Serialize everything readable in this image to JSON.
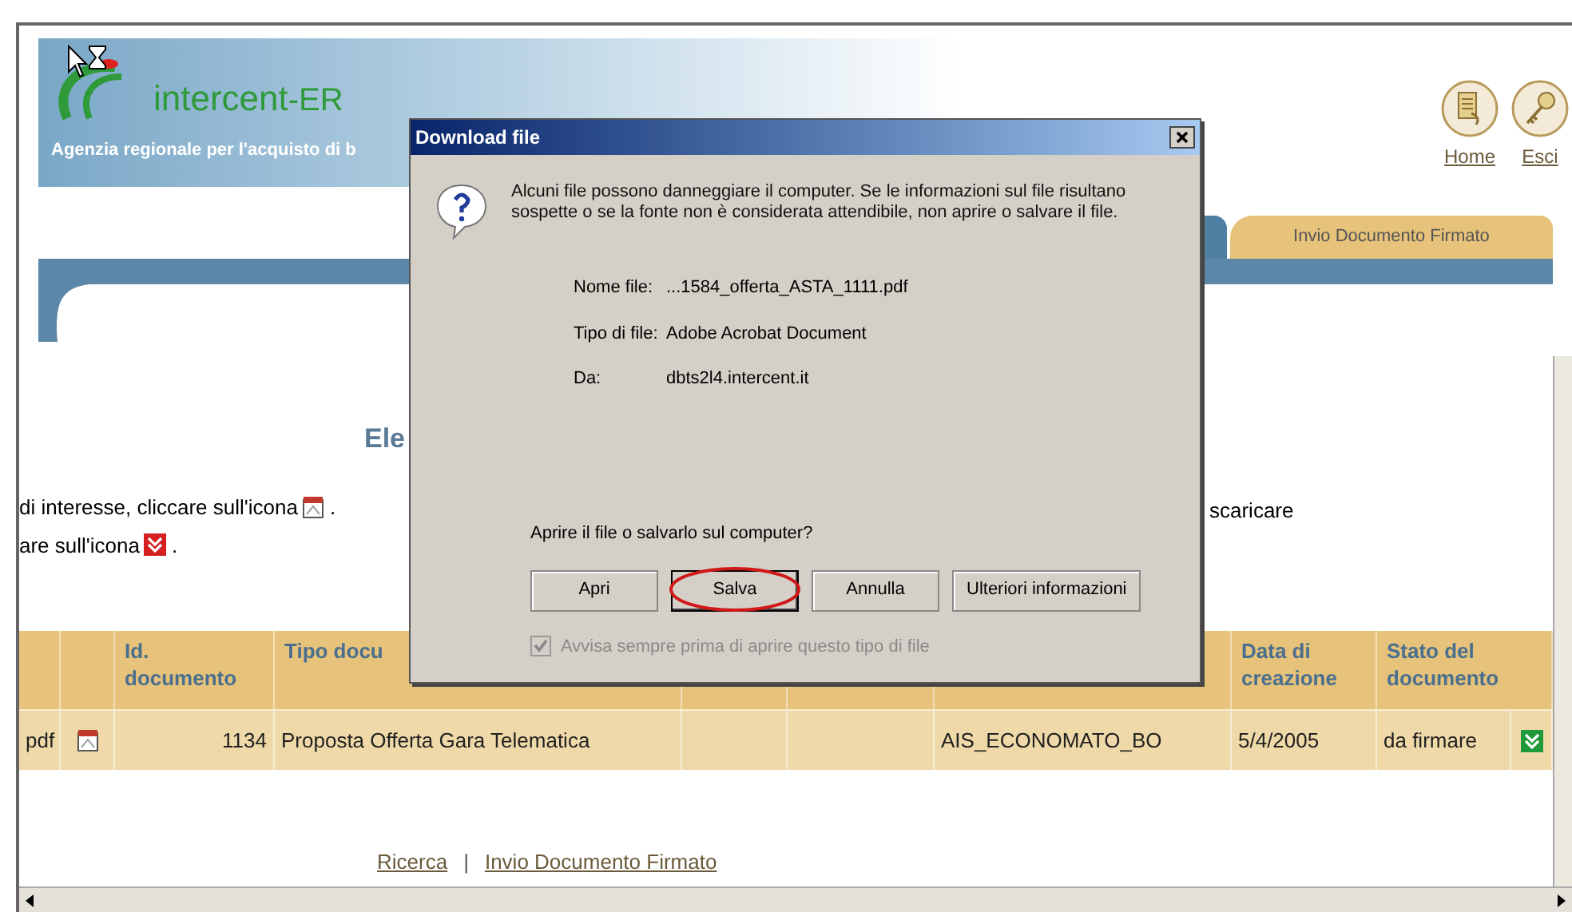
{
  "logo": {
    "name": "intercent",
    "suffix": "-ER"
  },
  "tagline": "Agenzia regionale per l'acquisto di b",
  "nav_links": [
    {
      "label": "Home",
      "kind": "home"
    },
    {
      "label": "Esci",
      "kind": "exit"
    }
  ],
  "tabs": [
    {
      "label": "Invio Documento Firmato",
      "selected": true
    }
  ],
  "page_title": "Ele",
  "instructions": [
    {
      "text": "di interesse, cliccare sull'icona",
      "kind": "pdf",
      "after": "."
    },
    {
      "text": "are sull'icona",
      "kind": "sign",
      "after": "."
    }
  ],
  "instructions_right": "scaricare",
  "table": {
    "columns": [
      {},
      {},
      {
        "label": "Id. documento"
      },
      {
        "label": "Tipo docu"
      },
      {},
      {},
      {},
      {
        "label": "Data di creazione"
      },
      {
        "label": "Stato del documento"
      }
    ],
    "rows": [
      {
        "cells": [
          {
            "kind": "text",
            "text": "pdf"
          },
          {
            "kind": "pdf"
          },
          {
            "kind": "text",
            "text": "1134"
          },
          {
            "kind": "text",
            "text": "Proposta Offerta Gara Telematica"
          },
          {
            "kind": "empty"
          },
          {
            "kind": "empty"
          },
          {
            "kind": "text",
            "text": "AIS_ECONOMATO_BO"
          },
          {
            "kind": "text",
            "text": "5/4/2005"
          },
          {
            "kind": "text",
            "text": "da firmare"
          },
          {
            "kind": "signdone"
          }
        ]
      }
    ]
  },
  "footer_links": [
    {
      "label": "Ricerca"
    },
    {
      "label": "Invio Documento Firmato"
    }
  ],
  "footer_separator": "|",
  "dialog": {
    "title": "Download file",
    "message": "Alcuni file possono danneggiare il computer. Se le informazioni sul file risultano sospette o se la fonte non è considerata attendibile, non aprire o salvare il file.",
    "fields": [
      {
        "label": "Nome file:",
        "value": "...1584_offerta_ASTA_1111.pdf"
      },
      {
        "label": "Tipo di file:",
        "value": "Adobe Acrobat Document"
      },
      {
        "label": "Da:",
        "value": "dbts2l4.intercent.it"
      }
    ],
    "question": "Aprire il file o salvarlo sul computer?",
    "buttons": [
      {
        "label": "Apri",
        "focused": false,
        "circled": false
      },
      {
        "label": "Salva",
        "focused": true,
        "circled": true
      },
      {
        "label": "Annulla",
        "focused": false,
        "circled": false
      },
      {
        "label": "Ulteriori informazioni",
        "focused": false,
        "circled": false
      }
    ],
    "checkbox": {
      "label": "Avvisa sempre prima di aprire questo tipo di file",
      "checked": true,
      "disabled": true
    }
  }
}
